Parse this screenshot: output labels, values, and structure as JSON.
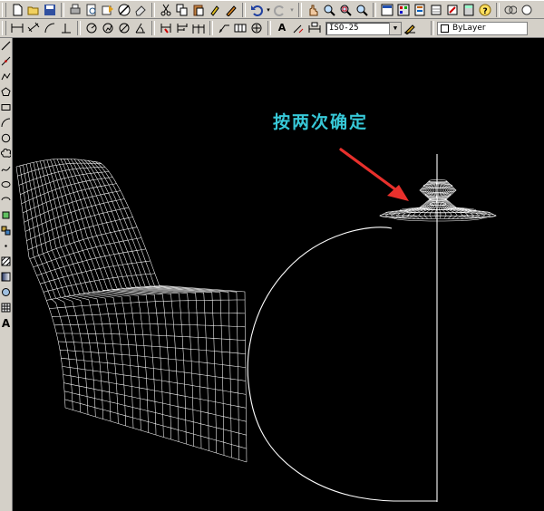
{
  "toolbar_standard": {
    "icons": [
      "new-file-icon",
      "open-file-icon",
      "save-icon",
      "print-icon",
      "print-preview-icon",
      "publish-icon",
      "plot-icon",
      "erase-icon",
      "cut-icon",
      "copy-icon",
      "paste-icon",
      "match-properties-icon",
      "undo-icon",
      "redo-icon",
      "pan-icon",
      "zoom-realtime-icon",
      "zoom-window-icon",
      "zoom-previous-icon",
      "properties-icon",
      "design-center-icon",
      "tool-palettes-icon",
      "sheet-set-icon",
      "markup-icon",
      "calculator-icon",
      "help-icon"
    ]
  },
  "toolbar_dimension": {
    "dim_style_value": "ISO-25",
    "layer_value": "ByLayer",
    "text_style_label": "A"
  },
  "sidebar": {
    "icons": [
      "line-icon",
      "construction-line-icon",
      "polyline-icon",
      "polygon-icon",
      "rectangle-icon",
      "arc-icon",
      "circle-icon",
      "revision-cloud-icon",
      "spline-icon",
      "ellipse-icon",
      "ellipse-arc-icon",
      "insert-block-icon",
      "make-block-icon",
      "point-icon",
      "hatch-icon",
      "gradient-icon",
      "region-icon",
      "table-icon",
      "multiline-text-icon"
    ],
    "text_tool_label": "A"
  },
  "canvas": {
    "background": "#000000",
    "annotation_text": "按两次确定",
    "annotation_color": "#37c8d7",
    "arrow_color": "#e8302c",
    "wire_color": "#ffffff"
  }
}
